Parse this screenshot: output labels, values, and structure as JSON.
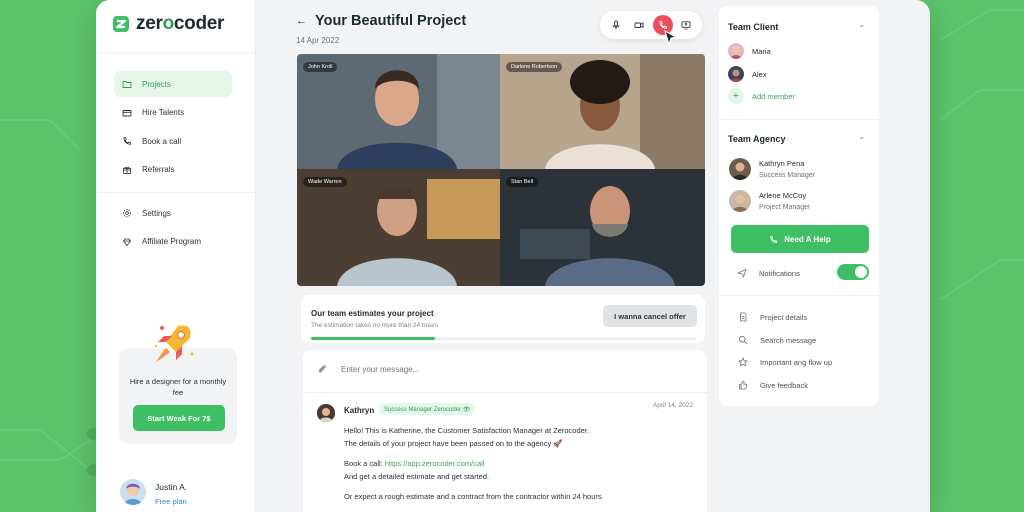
{
  "brand": {
    "name_prefix": "zer",
    "name_o": "o",
    "name_suffix": "coder"
  },
  "sidebar": {
    "items": [
      {
        "label": "Projects",
        "icon": "folder-icon",
        "active": true
      },
      {
        "label": "Hire Talents",
        "icon": "card-icon",
        "active": false
      },
      {
        "label": "Book a call",
        "icon": "phone-icon",
        "active": false
      },
      {
        "label": "Referrals",
        "icon": "gift-icon",
        "active": false
      }
    ],
    "items2": [
      {
        "label": "Settings",
        "icon": "gear-icon"
      },
      {
        "label": "Affiliate Program",
        "icon": "diamond-icon"
      }
    ],
    "promo": {
      "text": "Hire a designer for a monthly fee",
      "button": "Start Weak For 7$"
    },
    "user": {
      "name": "Justin A.",
      "plan": "Free plan"
    }
  },
  "project": {
    "title": "Your Beautiful Project",
    "date": "14 Apr 2022"
  },
  "call_controls": [
    "microphone-icon",
    "camera-icon",
    "end-call-icon",
    "share-screen-icon"
  ],
  "video": {
    "participants": [
      {
        "name": "John Kroll"
      },
      {
        "name": "Darlene Robertson"
      },
      {
        "name": "Wade Warren"
      },
      {
        "name": "Stan Bell"
      }
    ]
  },
  "estimate": {
    "title": "Our team estimates your project",
    "subtitle": "The estimation takes no more than 24 hours",
    "button": "I wanna cancel offer",
    "progress": 0.32
  },
  "chat": {
    "placeholder": "Enter your message...",
    "message": {
      "author": "Kathryn",
      "badge": "Success Manager Zerocoder 👁",
      "date": "April 14, 2022",
      "line1": "Hello! This is Katherine, the Customer Satisfaction Manager at Zerocoder.",
      "line2": "The details of your project have been passed on to the agency 🚀",
      "line3_prefix": "Book a call: ",
      "line3_link": "https://app.zerocoder.com/call",
      "line4": "And get a detailed estimate and get started.",
      "line5": "Or expect a rough estimate and a contract from the contractor within 24 hours."
    }
  },
  "team_client": {
    "title": "Team Client",
    "members": [
      {
        "name": "Maria"
      },
      {
        "name": "Alex"
      }
    ],
    "add_label": "Add member"
  },
  "team_agency": {
    "title": "Team Agency",
    "members": [
      {
        "name": "Kathryn Pena",
        "role": "Success Manager"
      },
      {
        "name": "Arlene McCoy",
        "role": "Project Manager"
      }
    ],
    "help_button": "Need A Help",
    "notifications_label": "Notifications",
    "notifications_on": true
  },
  "links": [
    {
      "label": "Project details",
      "icon": "document-icon"
    },
    {
      "label": "Search message",
      "icon": "search-icon"
    },
    {
      "label": "Important ang flow up",
      "icon": "star-icon"
    },
    {
      "label": "Give feedback",
      "icon": "thumbs-up-icon"
    }
  ],
  "colors": {
    "accent": "#3fbf63",
    "background": "#5cc46b",
    "end_call": "#ef4d5a"
  }
}
